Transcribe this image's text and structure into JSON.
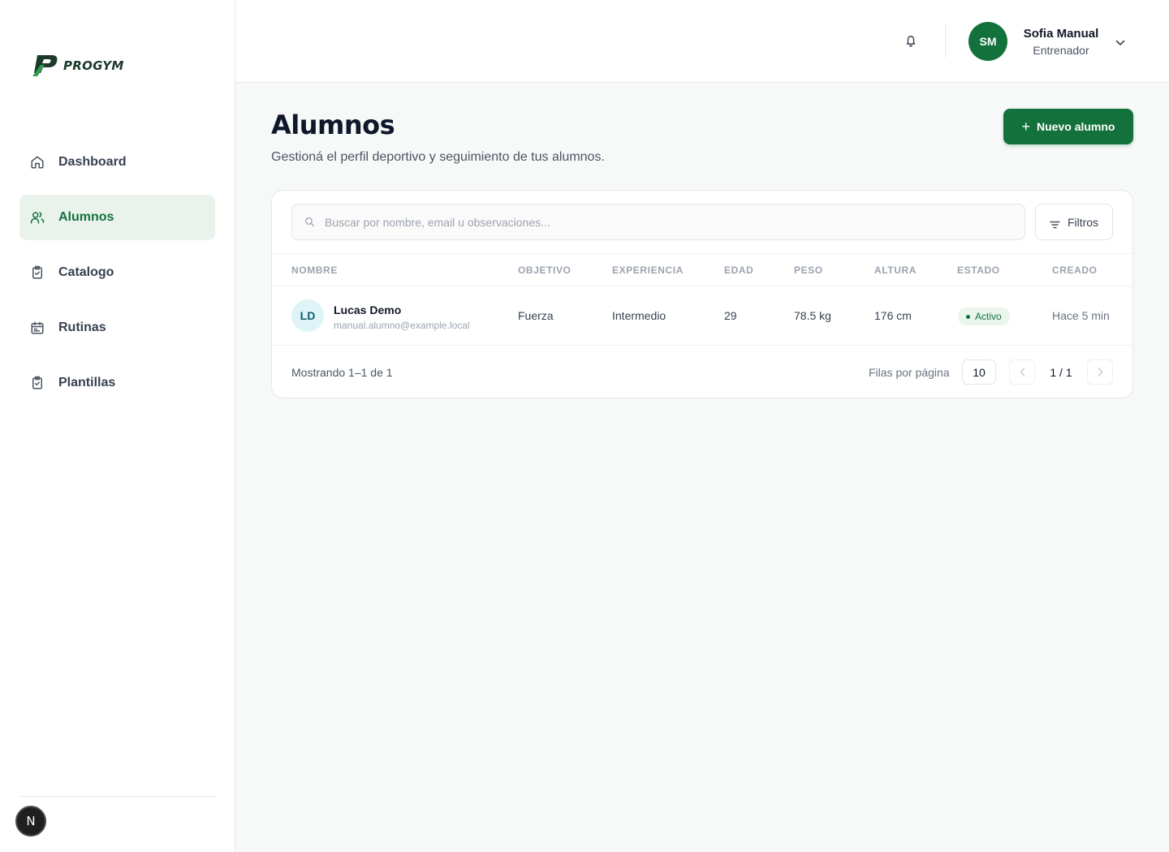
{
  "brand": {
    "name": "PROGYM",
    "accent": "#13713b"
  },
  "sidebar": {
    "items": [
      {
        "label": "Dashboard",
        "icon": "home-icon"
      },
      {
        "label": "Alumnos",
        "icon": "users-icon",
        "active": true
      },
      {
        "label": "Catalogo",
        "icon": "clipboard-check-icon"
      },
      {
        "label": "Rutinas",
        "icon": "calendar-icon"
      },
      {
        "label": "Plantillas",
        "icon": "clipboard-check-icon"
      }
    ],
    "badge": "N"
  },
  "header": {
    "user": {
      "initials": "SM",
      "name": "Sofia Manual",
      "role": "Entrenador"
    }
  },
  "main": {
    "title": "Alumnos",
    "subtitle": "Gestioná el perfil deportivo y seguimiento de tus alumnos.",
    "new_button": "Nuevo alumno",
    "search_placeholder": "Buscar por nombre, email u observaciones...",
    "filter_button": "Filtros",
    "table": {
      "columns": [
        "NOMBRE",
        "OBJETIVO",
        "EXPERIENCIA",
        "EDAD",
        "PESO",
        "ALTURA",
        "ESTADO",
        "CREADO"
      ],
      "rows": [
        {
          "initials": "LD",
          "name": "Lucas Demo",
          "email": "manual.alumno@example.local",
          "objetivo": "Fuerza",
          "experiencia": "Intermedio",
          "edad": "29",
          "peso": "78.5 kg",
          "altura": "176 cm",
          "estado": "Activo",
          "creado": "Hace 5 min"
        }
      ]
    },
    "footer": {
      "showing": "Mostrando 1–1 de 1",
      "rows_per_page_label": "Filas por página",
      "rows_per_page": "10",
      "page": "1 / 1"
    }
  }
}
